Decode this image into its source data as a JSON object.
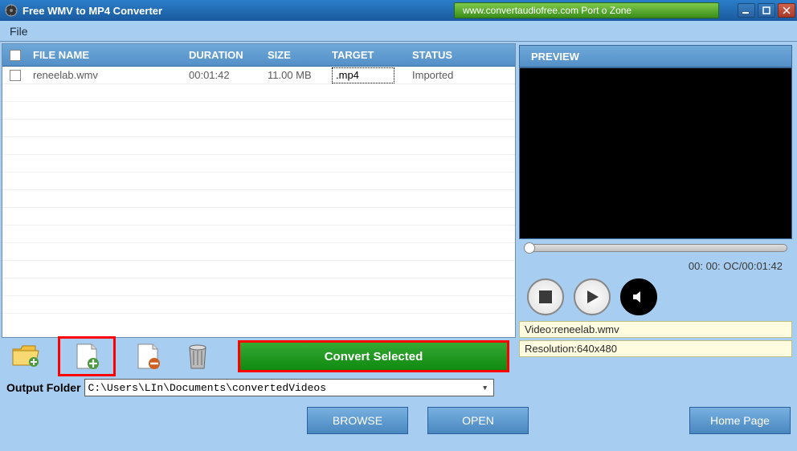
{
  "titlebar": {
    "app_title": "Free WMV to MP4 Converter",
    "banner": "www.convertaudiofree.com Port o Zone"
  },
  "menubar": {
    "file": "File"
  },
  "table": {
    "headers": {
      "name": "FILE NAME",
      "duration": "DURATION",
      "size": "SIZE",
      "target": "TARGET",
      "status": "STATUS"
    },
    "rows": [
      {
        "name": "reneelab.wmv",
        "duration": "00:01:42",
        "size": "11.00 MB",
        "target": ".mp4",
        "status": "Imported"
      }
    ]
  },
  "toolbar": {
    "convert": "Convert Selected"
  },
  "preview": {
    "header": "PREVIEW",
    "time": "00: 00: OC/00:01:42",
    "video_label": "Video:",
    "video_value": "reneelab.wmv",
    "res_label": "Resolution:",
    "res_value": "640x480"
  },
  "output": {
    "label": "Output Folder",
    "path": "C:\\Users\\LIn\\Documents\\convertedVideos"
  },
  "buttons": {
    "browse": "BROWSE",
    "open": "OPEN",
    "home": "Home Page"
  }
}
